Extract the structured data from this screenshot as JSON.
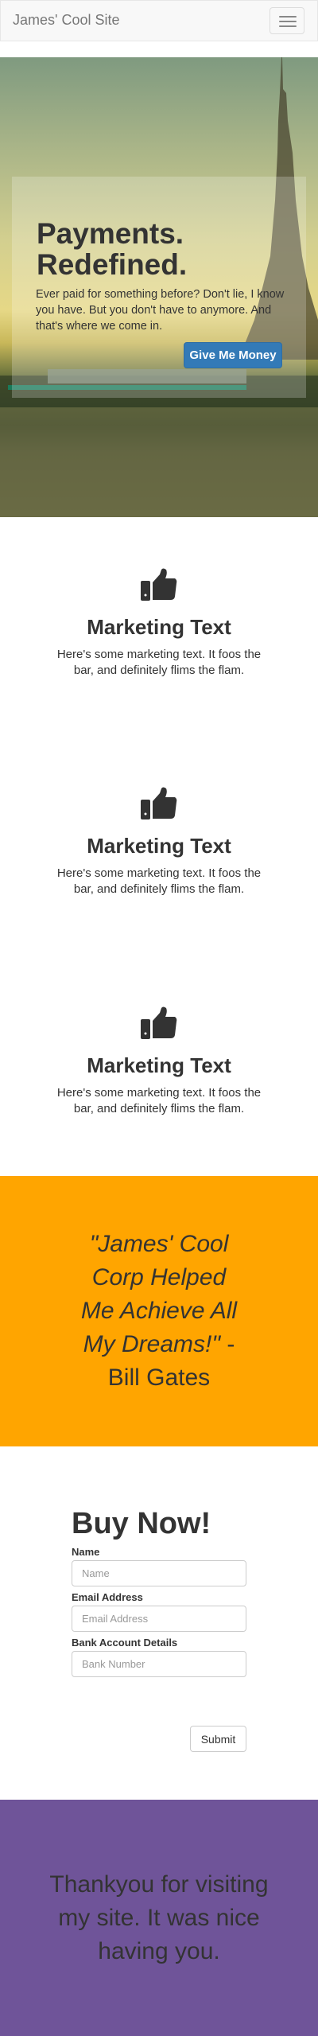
{
  "navbar": {
    "brand": "James' Cool Site",
    "menu_icon": "hamburger-icon"
  },
  "hero": {
    "title_line1": "Payments.",
    "title_line2": "Redefined.",
    "body": "Ever paid for something before? Don't lie, I know you have. But you don't have to anymore. And that's where we come in.",
    "button_label": "Give Me Money",
    "button_color": "#337ab7"
  },
  "marketing": [
    {
      "icon": "thumbs-up-icon",
      "title": "Marketing Text",
      "body": "Here's some marketing text. It foos the bar, and definitely flims the flam."
    },
    {
      "icon": "thumbs-up-icon",
      "title": "Marketing Text",
      "body": "Here's some marketing text. It foos the bar, and definitely flims the flam."
    },
    {
      "icon": "thumbs-up-icon",
      "title": "Marketing Text",
      "body": "Here's some marketing text. It foos the bar, and definitely flims the flam."
    }
  ],
  "testimonial": {
    "quote": "\"James' Cool Corp Helped Me Achieve All My Dreams!\"",
    "author": " - Bill Gates",
    "background": "#ffa500"
  },
  "buy_form": {
    "title": "Buy Now!",
    "name_label": "Name",
    "name_placeholder": "Name",
    "email_label": "Email Address",
    "email_placeholder": "Email Address",
    "bank_label": "Bank Account Details",
    "bank_placeholder": "Bank Number",
    "submit_label": "Submit"
  },
  "footer": {
    "text": "Thankyou for visiting my site. It was nice having you.",
    "background": "#6f5499"
  }
}
